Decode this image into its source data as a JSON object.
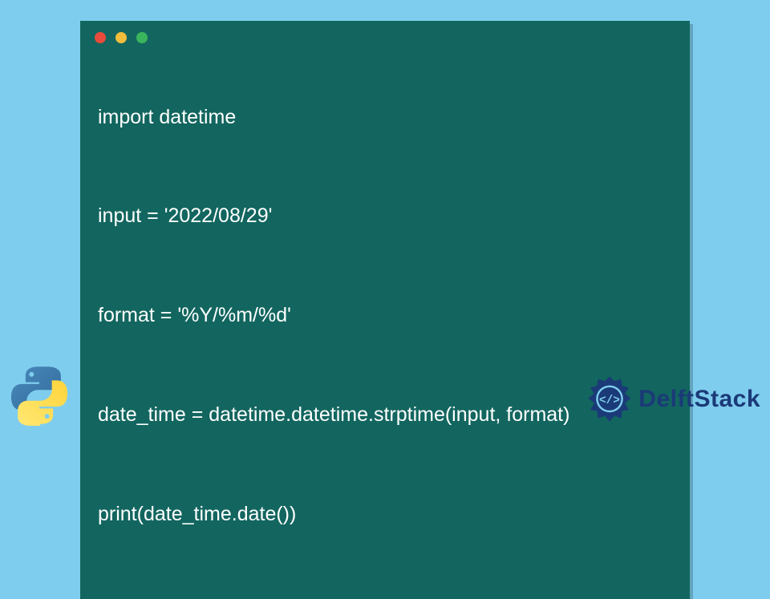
{
  "code": {
    "lines": [
      "import datetime",
      "input = '2022/08/29'",
      "format = '%Y/%m/%d'",
      "date_time = datetime.datetime.strptime(input, format)",
      "print(date_time.date())"
    ]
  },
  "brand": {
    "name": "DelftStack"
  },
  "window": {
    "dots": [
      "red",
      "yellow",
      "green"
    ]
  }
}
